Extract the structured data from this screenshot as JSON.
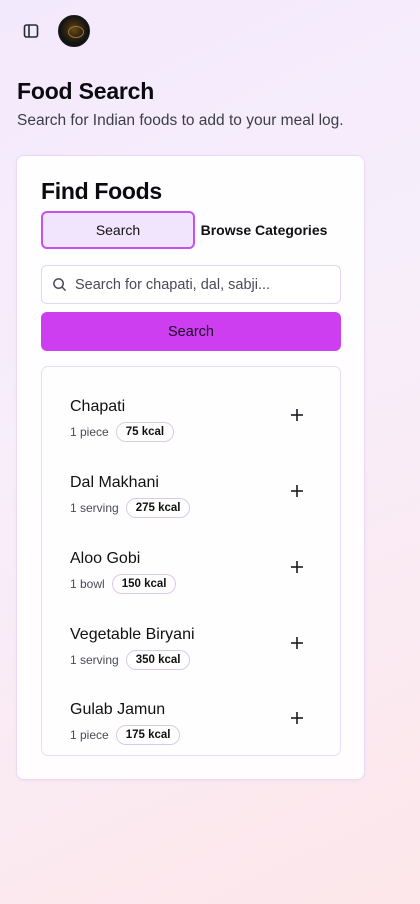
{
  "header": {
    "sidebar_toggle_icon": "panel-left-icon",
    "avatar_icon": "user-avatar"
  },
  "page": {
    "title": "Food Search",
    "subtitle": "Search for Indian foods to add to your meal log."
  },
  "card": {
    "title": "Find Foods",
    "tabs": [
      {
        "label": "Search",
        "active": true
      },
      {
        "label": "Browse Categories",
        "active": false
      }
    ],
    "search": {
      "placeholder": "Search for chapati, dal, sabji...",
      "value": "",
      "button_label": "Search"
    }
  },
  "foods": [
    {
      "name": "Chapati",
      "portion": "1 piece",
      "kcal": "75 kcal"
    },
    {
      "name": "Dal Makhani",
      "portion": "1 serving",
      "kcal": "275 kcal"
    },
    {
      "name": "Aloo Gobi",
      "portion": "1 bowl",
      "kcal": "150 kcal"
    },
    {
      "name": "Vegetable Biryani",
      "portion": "1 serving",
      "kcal": "350 kcal"
    },
    {
      "name": "Gulab Jamun",
      "portion": "1 piece",
      "kcal": "175 kcal"
    }
  ],
  "colors": {
    "accent": "#cd3ef0",
    "tab_active_bg": "#f1e4fd",
    "tab_active_border": "#c851ee"
  }
}
